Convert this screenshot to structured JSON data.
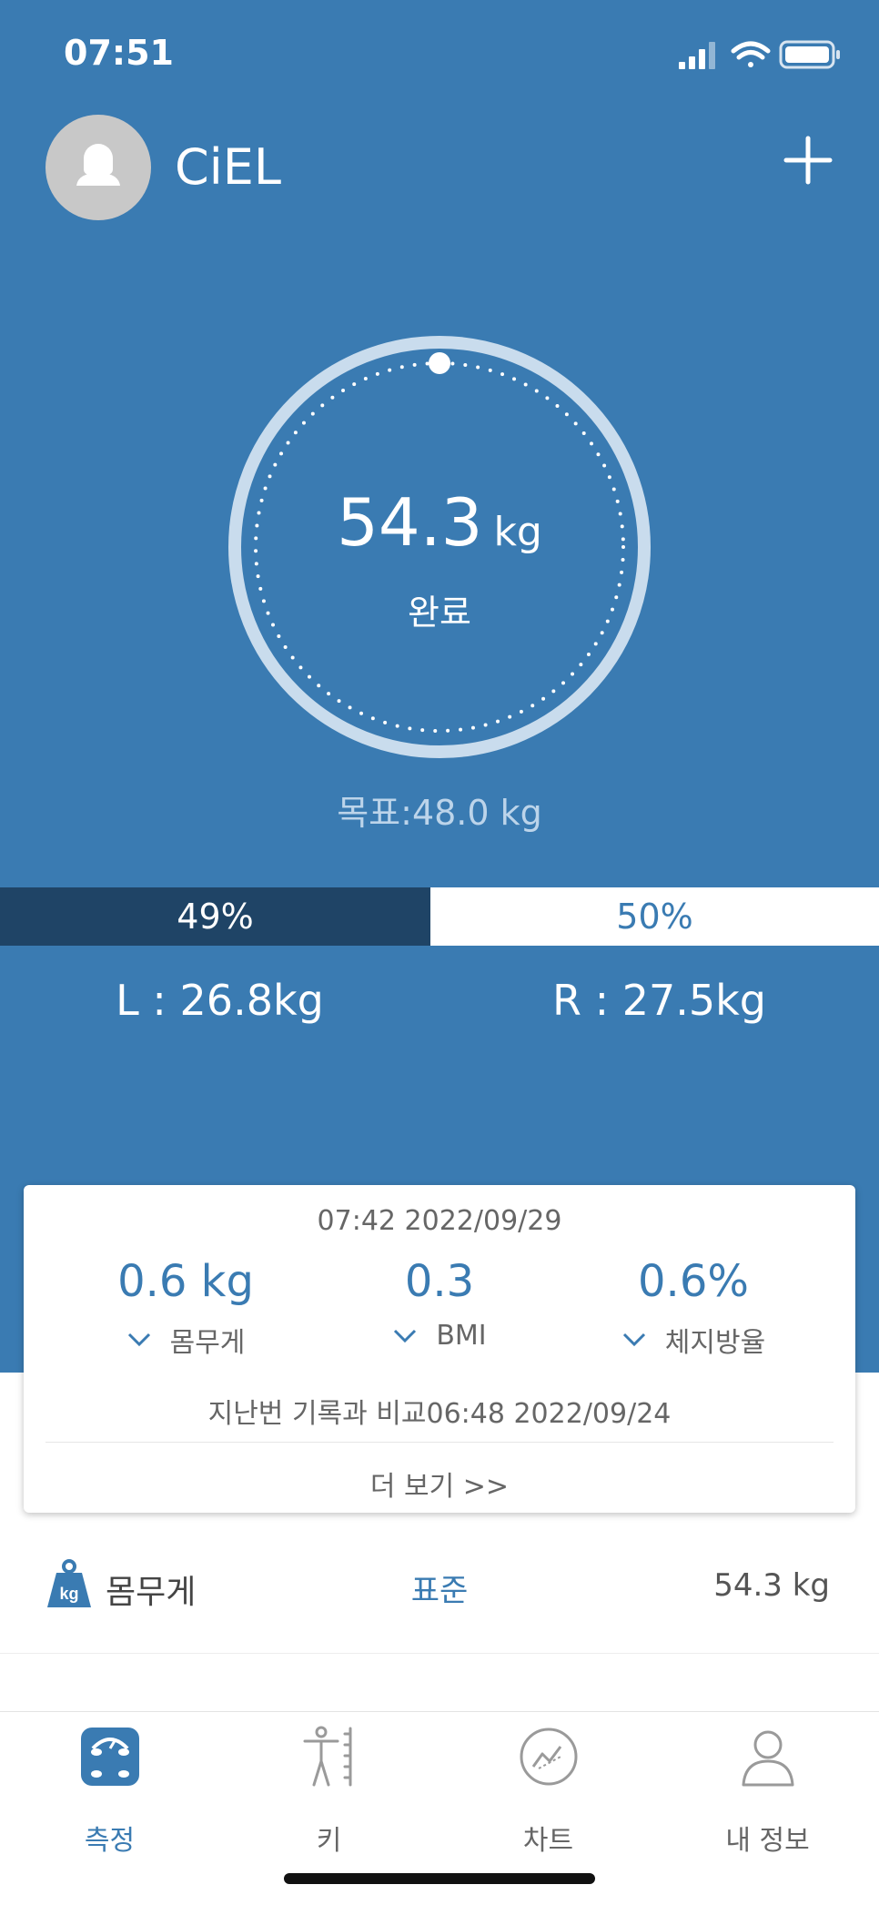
{
  "status_bar": {
    "time": "07:51"
  },
  "header": {
    "username": "CiEL"
  },
  "gauge": {
    "value": "54.3",
    "unit": "kg",
    "status": "완료",
    "goal": "목표:48.0 kg"
  },
  "balance": {
    "left_percent": "49%",
    "right_percent": "50%",
    "left_weight": "L : 26.8kg",
    "right_weight": "R : 27.5kg"
  },
  "comparison_card": {
    "date": "07:42 2022/09/29",
    "metrics": [
      {
        "value": "0.6 kg",
        "label": "몸무게",
        "trend": "down"
      },
      {
        "value": "0.3",
        "label": "BMI",
        "trend": "down"
      },
      {
        "value": "0.6%",
        "label": "체지방율",
        "trend": "down"
      }
    ],
    "compare_text": "지난번 기록과 비교06:48 2022/09/24",
    "more_label": "더 보기 >>"
  },
  "weight_row": {
    "label": "몸무게",
    "status": "표준",
    "value": "54.3 kg",
    "icon": "kg-weight-icon"
  },
  "tabs": [
    {
      "label": "측정",
      "icon": "scale-icon",
      "active": true
    },
    {
      "label": "키",
      "icon": "height-icon",
      "active": false
    },
    {
      "label": "차트",
      "icon": "chart-icon",
      "active": false
    },
    {
      "label": "내 정보",
      "icon": "profile-icon",
      "active": false
    }
  ],
  "colors": {
    "primary": "#3a7bb2",
    "dark": "#1f4466",
    "text_gray": "#666666"
  }
}
